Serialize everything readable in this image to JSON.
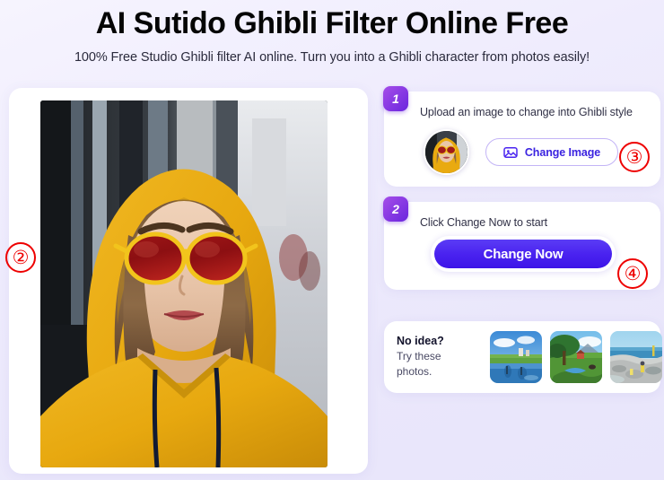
{
  "header": {
    "title": "AI Sutido Ghibli Filter Online Free",
    "subtitle": "100% Free Studio Ghibli filter AI online. Turn you into a Ghibli character from photos easily!"
  },
  "preview": {
    "name": "uploaded-photo-preview",
    "description": "Woman wearing yellow hoodie and yellow-rimmed red sunglasses on a city street"
  },
  "steps": [
    {
      "badge": "1",
      "instruction": "Upload an image to change into Ghibli style",
      "button_label": "Change Image",
      "icon": "image-icon",
      "thumbnail": "current-upload-thumbnail"
    },
    {
      "badge": "2",
      "instruction": "Click Change Now to start",
      "button_label": "Change Now"
    }
  ],
  "samples": {
    "title": "No idea?",
    "subtitle_line1": "Try these",
    "subtitle_line2": "photos.",
    "items": [
      {
        "name": "sample-photo-lake-village"
      },
      {
        "name": "sample-photo-tree-meadow"
      },
      {
        "name": "sample-photo-seaside-rocks"
      }
    ]
  },
  "annotations": [
    {
      "label": "②",
      "target": "preview-image"
    },
    {
      "label": "③",
      "target": "change-image-button"
    },
    {
      "label": "④",
      "target": "change-now-button"
    }
  ],
  "colors": {
    "page_background": "#eae7fb",
    "accent_purple": "#6a25dd",
    "button_blue": "#4a23f0",
    "marker_red": "#ee0000",
    "card_white": "#ffffff"
  }
}
